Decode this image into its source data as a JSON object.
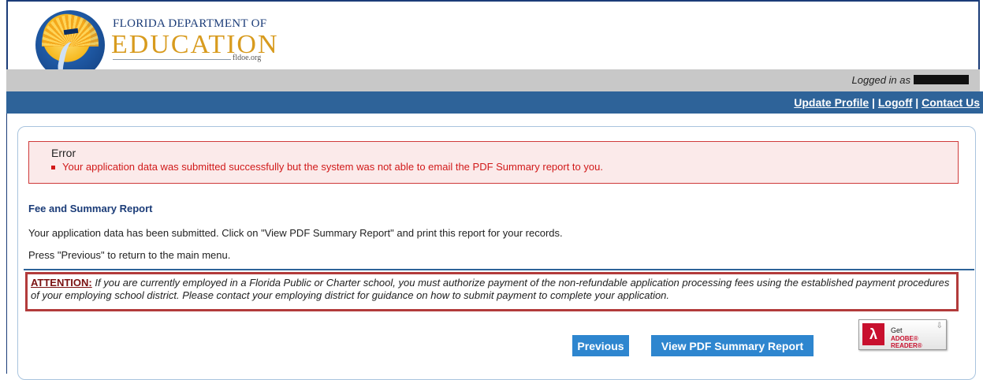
{
  "header": {
    "logo_line1": "FLORIDA DEPARTMENT OF",
    "logo_line2": "EDUCATION",
    "logo_url": "fldoe.org"
  },
  "user_bar": {
    "logged_in_label": "Logged in as"
  },
  "nav": {
    "update_profile": "Update Profile",
    "logoff": "Logoff",
    "contact_us": "Contact Us",
    "separator": " | "
  },
  "error": {
    "title": "Error",
    "message": "Your application data was submitted successfully but the system was not able to email the PDF Summary report to you."
  },
  "main": {
    "section_title": "Fee and Summary Report",
    "paragraph1": "Your application data has been submitted. Click on \"View PDF Summary Report\" and print this report for your records.",
    "paragraph2": "Press \"Previous\" to return to the main menu."
  },
  "attention": {
    "label": "ATTENTION:",
    "text": "If you are currently employed in a Florida Public or Charter school, you must authorize payment of the non-refundable application processing fees using the established payment procedures of your employing school district. Please contact your employing district for guidance on how to submit payment to complete your application."
  },
  "adobe": {
    "get": "Get",
    "reader": "ADOBE® READER®"
  },
  "buttons": {
    "previous": "Previous",
    "view_pdf": "View PDF Summary Report"
  },
  "colors": {
    "nav_blue": "#2e6399",
    "error_red": "#d11a1a",
    "button_blue": "#2e86cf"
  }
}
